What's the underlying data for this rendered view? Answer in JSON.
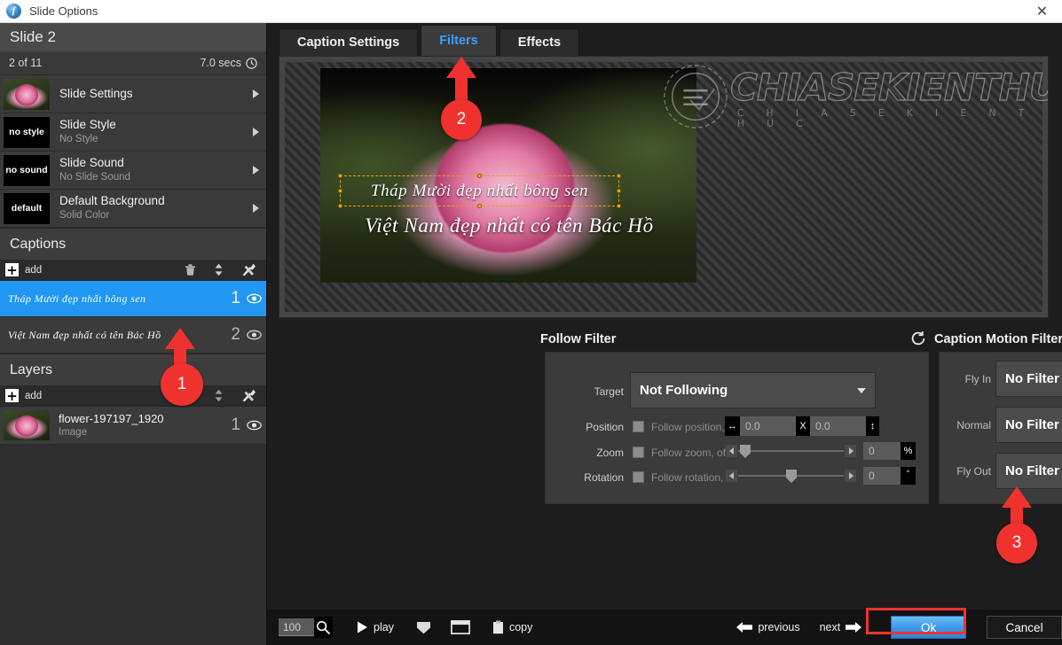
{
  "window": {
    "title": "Slide Options",
    "app_icon": "app-logo-icon",
    "close_label": "✕"
  },
  "sidebar": {
    "slide_title": "Slide 2",
    "position": "2 of 11",
    "duration": "7.0 secs",
    "clock_icon": "clock-icon",
    "options": [
      {
        "thumb": "flower-thumb",
        "thumb_text": "",
        "title": "Slide Settings",
        "desc": ""
      },
      {
        "thumb": "text-thumb",
        "thumb_text": "no style",
        "title": "Slide Style",
        "desc": "No Style"
      },
      {
        "thumb": "text-thumb",
        "thumb_text": "no sound",
        "title": "Slide Sound",
        "desc": "No Slide Sound"
      },
      {
        "thumb": "text-thumb",
        "thumb_text": "default",
        "title": "Default Background",
        "desc": "Solid Color"
      }
    ],
    "captions": {
      "header": "Captions",
      "add_label": "add",
      "tool_icons": [
        "trash-icon",
        "reorder-icon",
        "tools-icon"
      ],
      "items": [
        {
          "text": "Tháp Mười đẹp nhất bông sen",
          "num": "1",
          "selected": true
        },
        {
          "text": "Việt Nam đẹp nhất có tên Bác Hồ",
          "num": "2",
          "selected": false
        }
      ]
    },
    "layers": {
      "header": "Layers",
      "add_label": "add",
      "tool_icons": [
        "trash-icon",
        "reorder-icon",
        "tools-icon"
      ],
      "items": [
        {
          "name": "flower-197197_1920",
          "kind": "Image",
          "num": "1"
        }
      ]
    }
  },
  "tabs": [
    {
      "label": "Caption Settings",
      "active": false
    },
    {
      "label": "Filters",
      "active": true
    },
    {
      "label": "Effects",
      "active": false
    }
  ],
  "preview": {
    "caption_line1": "Tháp Mười đẹp nhất bông sen",
    "caption_line2": "Việt Nam đẹp nhất có tên Bác Hồ",
    "watermark_text": "CHIASEKIENTHUC",
    "watermark_sub": "C H I A  S E  K I E N  T H U C"
  },
  "follow_filter": {
    "title": "Follow Filter",
    "reset_icon": "reset-icon",
    "target_label": "Target",
    "target_value": "Not Following",
    "rows": [
      {
        "label": "Position",
        "checkbox_label": "Follow position, offset"
      },
      {
        "label": "Zoom",
        "checkbox_label": "Follow zoom, offset"
      },
      {
        "label": "Rotation",
        "checkbox_label": "Follow rotation, offset"
      }
    ],
    "position_x": "0.0",
    "position_y": "0.0",
    "position_sep": "X",
    "position_icon_h": "horizontal-arrows-icon",
    "position_icon_v": "vertical-arrows-icon",
    "zoom_value": "0",
    "zoom_unit": "%",
    "rotation_value": "0",
    "rotation_unit": "°"
  },
  "motion_filters": {
    "title": "Caption Motion Filters",
    "reset_icon": "reset-icon",
    "rows": [
      {
        "label": "Fly In",
        "value": "No Filter",
        "browse": "browse"
      },
      {
        "label": "Normal",
        "value": "No Filter",
        "browse": "browse"
      },
      {
        "label": "Fly Out",
        "value": "No Filter",
        "browse": "browse"
      }
    ]
  },
  "bottom_bar": {
    "zoom_value": "100",
    "search_icon": "magnifier-icon",
    "play_label": "play",
    "play_icon": "play-icon",
    "shield_icon": "shield-icon",
    "window_icon": "window-icon",
    "copy_label": "copy",
    "copy_icon": "clipboard-icon",
    "previous_label": "previous",
    "next_label": "next",
    "ok_label": "Ok",
    "cancel_label": "Cancel"
  },
  "annotations": [
    {
      "num": "1"
    },
    {
      "num": "2"
    },
    {
      "num": "3"
    }
  ],
  "colors": {
    "accent_blue": "#2196f3",
    "annotation_red": "#f0322f",
    "tab_active_text": "#3d9ff5",
    "panel_bg": "#3b3b3b"
  }
}
